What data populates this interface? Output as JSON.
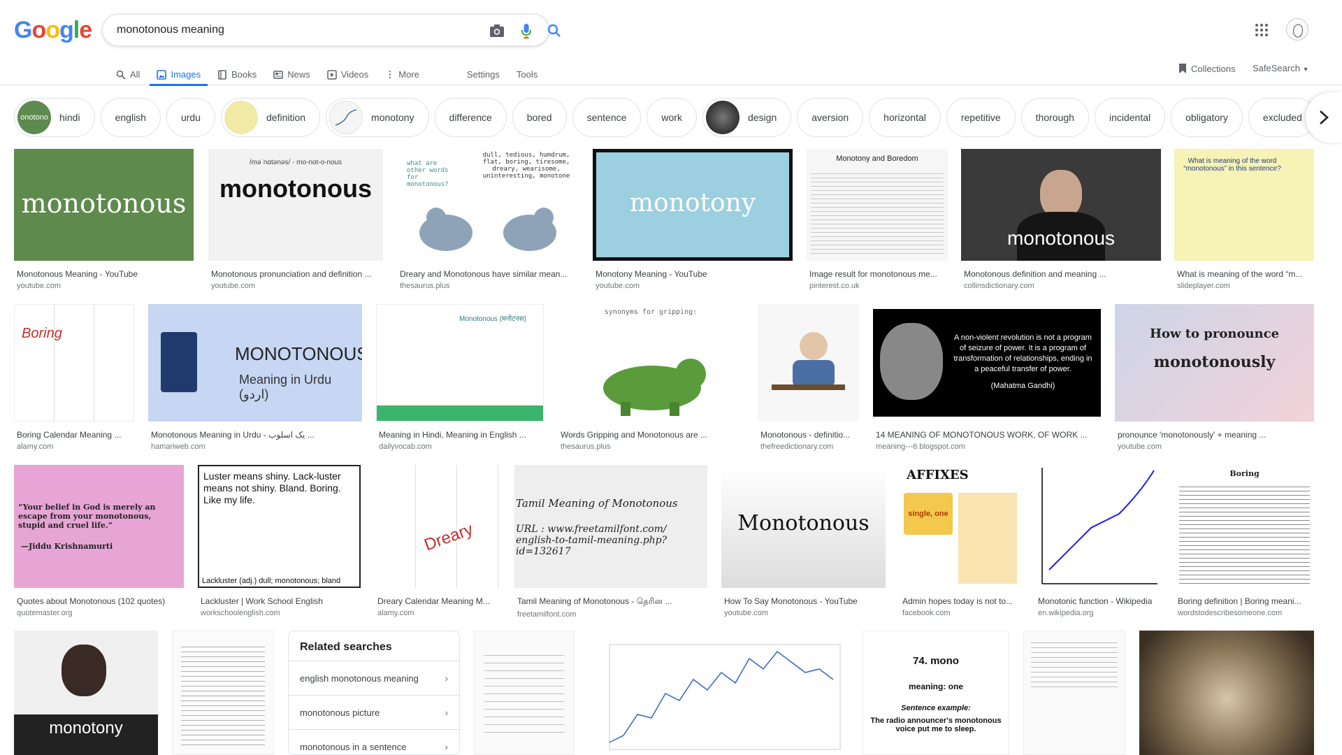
{
  "search": {
    "query": "monotonous meaning"
  },
  "logo": [
    "G",
    "o",
    "o",
    "g",
    "l",
    "e"
  ],
  "tabs": {
    "all": "All",
    "images": "Images",
    "books": "Books",
    "news": "News",
    "videos": "Videos",
    "more": "More",
    "settings": "Settings",
    "tools": "Tools"
  },
  "header_right": {
    "collections": "Collections",
    "safesearch": "SafeSearch"
  },
  "chips": [
    "hindi",
    "english",
    "urdu",
    "definition",
    "monotony",
    "difference",
    "bored",
    "sentence",
    "work",
    "design",
    "aversion",
    "horizontal",
    "repetitive",
    "thorough",
    "incidental",
    "obligatory",
    "excluded"
  ],
  "chip_thumb_text": {
    "hindi": "onotono"
  },
  "results": [
    {
      "caption": "Monotonous Meaning - YouTube",
      "source": "youtube.com",
      "art": "monotonous"
    },
    {
      "caption": "Monotonous pronunciation and definition ...",
      "source": "youtube.com",
      "art": "monotonous",
      "art_sub": "/məˈnɑtənəs/ - mo-not-o-nous"
    },
    {
      "caption": "Dreary and Monotonous have similar mean...",
      "source": "thesaurus.plus",
      "art": "what are other words for monotonous?",
      "art_sub": "dull, tedious, humdrum, flat, boring, tiresome, dreary, wearisome, uninteresting, monotone"
    },
    {
      "caption": "Monotony Meaning - YouTube",
      "source": "youtube.com",
      "art": "monotony"
    },
    {
      "caption": "Image result for monotonous me...",
      "source": "pinterest.co.uk",
      "art": "Monotony and Boredom"
    },
    {
      "caption": "Monotonous definition and meaning ...",
      "source": "collinsdictionary.com",
      "art": "monotonous"
    },
    {
      "caption": "What is meaning of the word “m...",
      "source": "slideplayer.com",
      "art": "What is meaning of the word “monotonous” in this sentence?"
    },
    {
      "caption": "Boring Calendar Meaning ...",
      "source": "alamy.com",
      "art": "Boring"
    },
    {
      "caption": "Monotonous Meaning in Urdu - یک اسلوب ...",
      "source": "hamariweb.com",
      "art": "MONOTONOUS",
      "art_sub": "Meaning in Urdu (اردو)"
    },
    {
      "caption": "Meaning in Hindi, Meaning in English ...",
      "source": "dailyvocab.com",
      "art": "Monotonous (मनोटनस)"
    },
    {
      "caption": "Words Gripping and Monotonous are ...",
      "source": "thesaurus.plus",
      "art": "synonyms for gripping:"
    },
    {
      "caption": "Monotonous - definitio...",
      "source": "thefreedictionary.com"
    },
    {
      "caption": "14 MEANING OF MONOTONOUS WORK, OF WORK ...",
      "source": "meaning---6.blogspot.com",
      "art": "A non-violent revolution is not a program of seizure of power. It is a program of transformation of relationships, ending in a peaceful transfer of power.",
      "art_sub": "(Mahatma Gandhi)"
    },
    {
      "caption": "pronounce 'monotonously' + meaning ...",
      "source": "youtube.com",
      "art": "How to pronounce",
      "art_sub": "monotonously"
    },
    {
      "caption": "Quotes about Monotonous (102 quotes)",
      "source": "quotemaster.org",
      "art": "“Your belief in God is merely an escape from your monotonous, stupid and cruel life.”",
      "art_sub": "—Jiddu Krishnamurti"
    },
    {
      "caption": "Lackluster | Work School English",
      "source": "workschoolenglish.com",
      "art": "Luster means shiny. Lack-luster means not shiny. Bland. Boring. Like my life.",
      "art_sub": "Lackluster (adj.) dull; monotonous; bland"
    },
    {
      "caption": "Dreary Calendar Meaning M...",
      "source": "alamy.com",
      "art": "Dreary"
    },
    {
      "caption": "Tamil Meaning of Monotonous - தெரின ...",
      "source": "freetamilfont.com",
      "art": "Tamil Meaning of Monotonous",
      "art_sub": "URL : www.freetamilfont.com/ english-to-tamil-meaning.php?id=132617"
    },
    {
      "caption": "How To Say Monotonous - YouTube",
      "source": "youtube.com",
      "art": "Monotonous"
    },
    {
      "caption": "Admin hopes today is not to...",
      "source": "facebook.com",
      "art": "AFFIXES",
      "art_sub": "single, one"
    },
    {
      "caption": "Monotonic function - Wikipedia",
      "source": "en.wikipedia.org"
    },
    {
      "caption": "Boring definition | Boring meani...",
      "source": "wordstodescribesomeone.com",
      "art": "Boring"
    },
    {
      "art": "monotony"
    },
    {
      "art": ""
    },
    {
      "art": ""
    },
    {
      "art": ""
    },
    {
      "art": "74. mono",
      "art_sub": "meaning: one",
      "art_sub2": "Sentence example:",
      "art_sub3": "The radio announcer's monotonous voice put me to sleep."
    },
    {
      "art": ""
    },
    {
      "art": ""
    }
  ],
  "related": {
    "title": "Related searches",
    "items": [
      "english monotonous meaning",
      "monotonous picture",
      "monotonous in a sentence"
    ]
  },
  "colors": {
    "accent": "#1a73e8",
    "text": "#202124",
    "muted": "#70757a"
  }
}
